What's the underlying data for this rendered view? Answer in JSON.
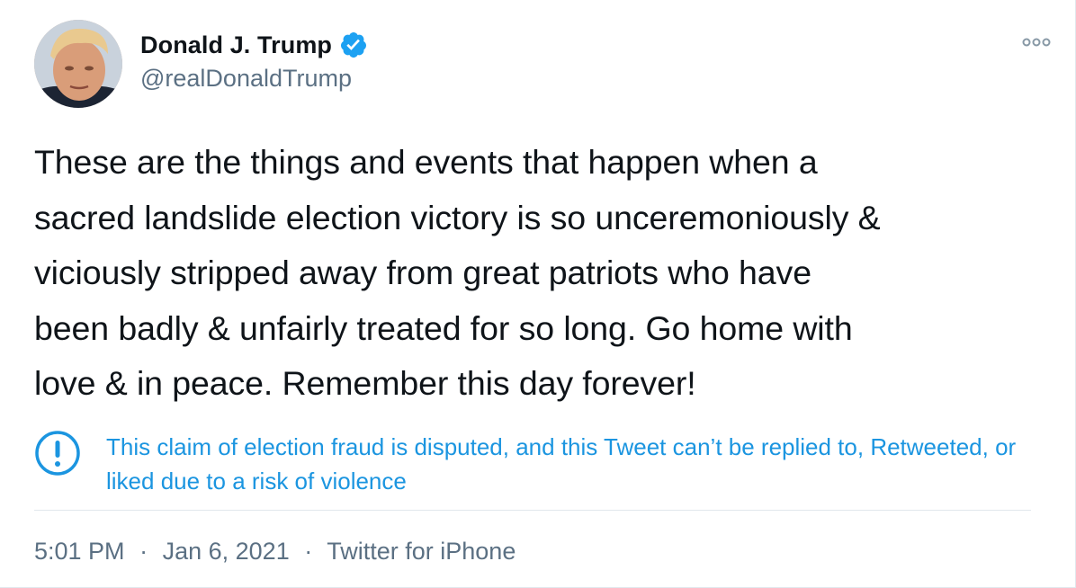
{
  "author": {
    "display_name": "Donald J. Trump",
    "handle": "@realDonaldTrump",
    "verified": true
  },
  "tweet": {
    "text": "These are the things and events that happen when a\nsacred landslide election victory is so unceremoniously &\nviciously stripped away from great patriots who have\nbeen badly & unfairly treated for so long. Go home with\nlove & in peace. Remember this day forever!"
  },
  "notice": {
    "icon": "exclamation-circle-icon",
    "text": "This claim of election fraud is disputed, and this Tweet can’t be replied to, Retweeted, or liked due to a risk of violence"
  },
  "meta": {
    "time": "5:01 PM",
    "separator": "·",
    "date": "Jan 6, 2021",
    "source": "Twitter for iPhone"
  },
  "colors": {
    "text": "#0f1419",
    "secondary": "#5b7083",
    "link": "#1b95e0",
    "verified": "#1da1f2",
    "divider": "#e1e8ed"
  }
}
